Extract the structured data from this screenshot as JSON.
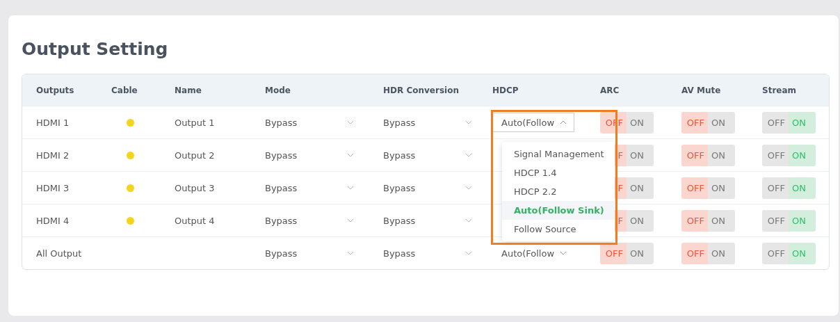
{
  "title": "Output Setting",
  "columns": [
    "Outputs",
    "Cable",
    "Name",
    "Mode",
    "HDR Conversion",
    "HDCP",
    "ARC",
    "AV Mute",
    "Stream"
  ],
  "rows": [
    {
      "output": "HDMI 1",
      "cable": true,
      "name": "Output 1",
      "mode": "Bypass",
      "hdr": "Bypass",
      "hdcp": {
        "value": "Auto(Follow",
        "open": true
      },
      "arc": {
        "off_label": "OFF",
        "on_label": "ON",
        "on": false
      },
      "av_mute": {
        "off_label": "OFF",
        "on_label": "ON",
        "on": false
      },
      "stream": {
        "off_label": "OFF",
        "on_label": "ON",
        "on": true
      }
    },
    {
      "output": "HDMI 2",
      "cable": true,
      "name": "Output 2",
      "mode": "Bypass",
      "hdr": "Bypass",
      "arc": {
        "off_label": "F",
        "on_label": "ON",
        "on": false
      },
      "av_mute": {
        "off_label": "OFF",
        "on_label": "ON",
        "on": false
      },
      "stream": {
        "off_label": "OFF",
        "on_label": "ON",
        "on": true
      }
    },
    {
      "output": "HDMI 3",
      "cable": true,
      "name": "Output 3",
      "mode": "Bypass",
      "hdr": "Bypass",
      "arc": {
        "off_label": "F",
        "on_label": "ON",
        "on": false
      },
      "av_mute": {
        "off_label": "OFF",
        "on_label": "ON",
        "on": false
      },
      "stream": {
        "off_label": "OFF",
        "on_label": "ON",
        "on": true
      }
    },
    {
      "output": "HDMI 4",
      "cable": true,
      "name": "Output 4",
      "mode": "Bypass",
      "hdr": "Bypass",
      "arc": {
        "off_label": "F",
        "on_label": "ON",
        "on": false
      },
      "av_mute": {
        "off_label": "OFF",
        "on_label": "ON",
        "on": false
      },
      "stream": {
        "off_label": "OFF",
        "on_label": "ON",
        "on": true
      }
    },
    {
      "output": "All Output",
      "cable": false,
      "mode": "Bypass",
      "hdr": "Bypass",
      "hdcp": {
        "value": "Auto(Follow",
        "open": false
      },
      "arc": {
        "off_label": "OFF",
        "on_label": "ON",
        "on": false
      },
      "av_mute": {
        "off_label": "OFF",
        "on_label": "ON",
        "on": false
      },
      "stream": {
        "off_label": "OFF",
        "on_label": "ON",
        "on": true
      }
    }
  ],
  "hdcp_menu": {
    "highlighted": true,
    "options": [
      {
        "label": "Signal Management",
        "selected": false
      },
      {
        "label": "HDCP 1.4",
        "selected": false
      },
      {
        "label": "HDCP 2.2",
        "selected": false
      },
      {
        "label": "Auto(Follow Sink)",
        "selected": true
      },
      {
        "label": "Follow Source",
        "selected": false
      }
    ]
  }
}
